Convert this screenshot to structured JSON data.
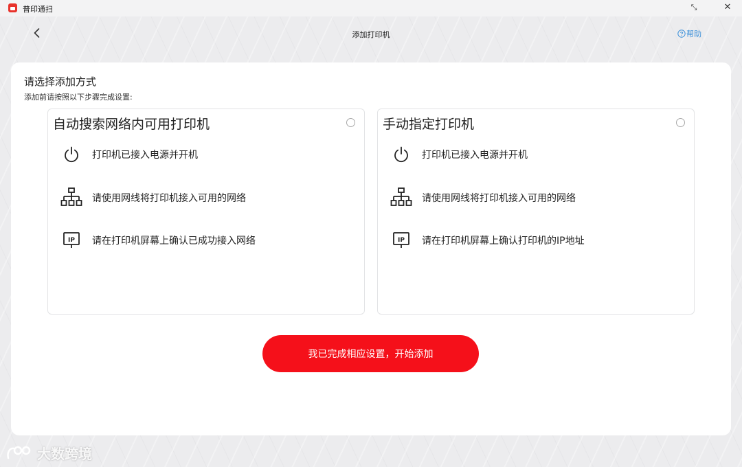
{
  "window": {
    "app_title": "普印通扫",
    "min_glyph": "⤡",
    "close_glyph": "✕"
  },
  "header": {
    "title": "添加打印机",
    "help_label": "帮助",
    "back_icon": "chevron-left-icon",
    "help_icon": "question-circle-icon"
  },
  "main": {
    "heading": "请选择添加方式",
    "subheading": "添加前请按照以下步骤完成设置:",
    "options": [
      {
        "title": "自动搜索网络内可用打印机",
        "selected": false,
        "steps": [
          {
            "icon": "power-icon",
            "text": "打印机已接入电源并开机"
          },
          {
            "icon": "network-icon",
            "text": "请使用网线将打印机接入可用的网络"
          },
          {
            "icon": "ip-address-icon",
            "text": "请在打印机屏幕上确认已成功接入网络"
          }
        ]
      },
      {
        "title": "手动指定打印机",
        "selected": false,
        "steps": [
          {
            "icon": "power-icon",
            "text": "打印机已接入电源并开机"
          },
          {
            "icon": "network-icon",
            "text": "请使用网线将打印机接入可用的网络"
          },
          {
            "icon": "ip-address-icon",
            "text": "请在打印机屏幕上确认打印机的IP地址"
          }
        ]
      }
    ],
    "ip_icon_label": "IP",
    "confirm_button": "我已完成相应设置，开始添加"
  },
  "watermark": {
    "text": "大数跨境"
  },
  "colors": {
    "accent": "#f5101a",
    "help_link": "#3a8fd9"
  }
}
